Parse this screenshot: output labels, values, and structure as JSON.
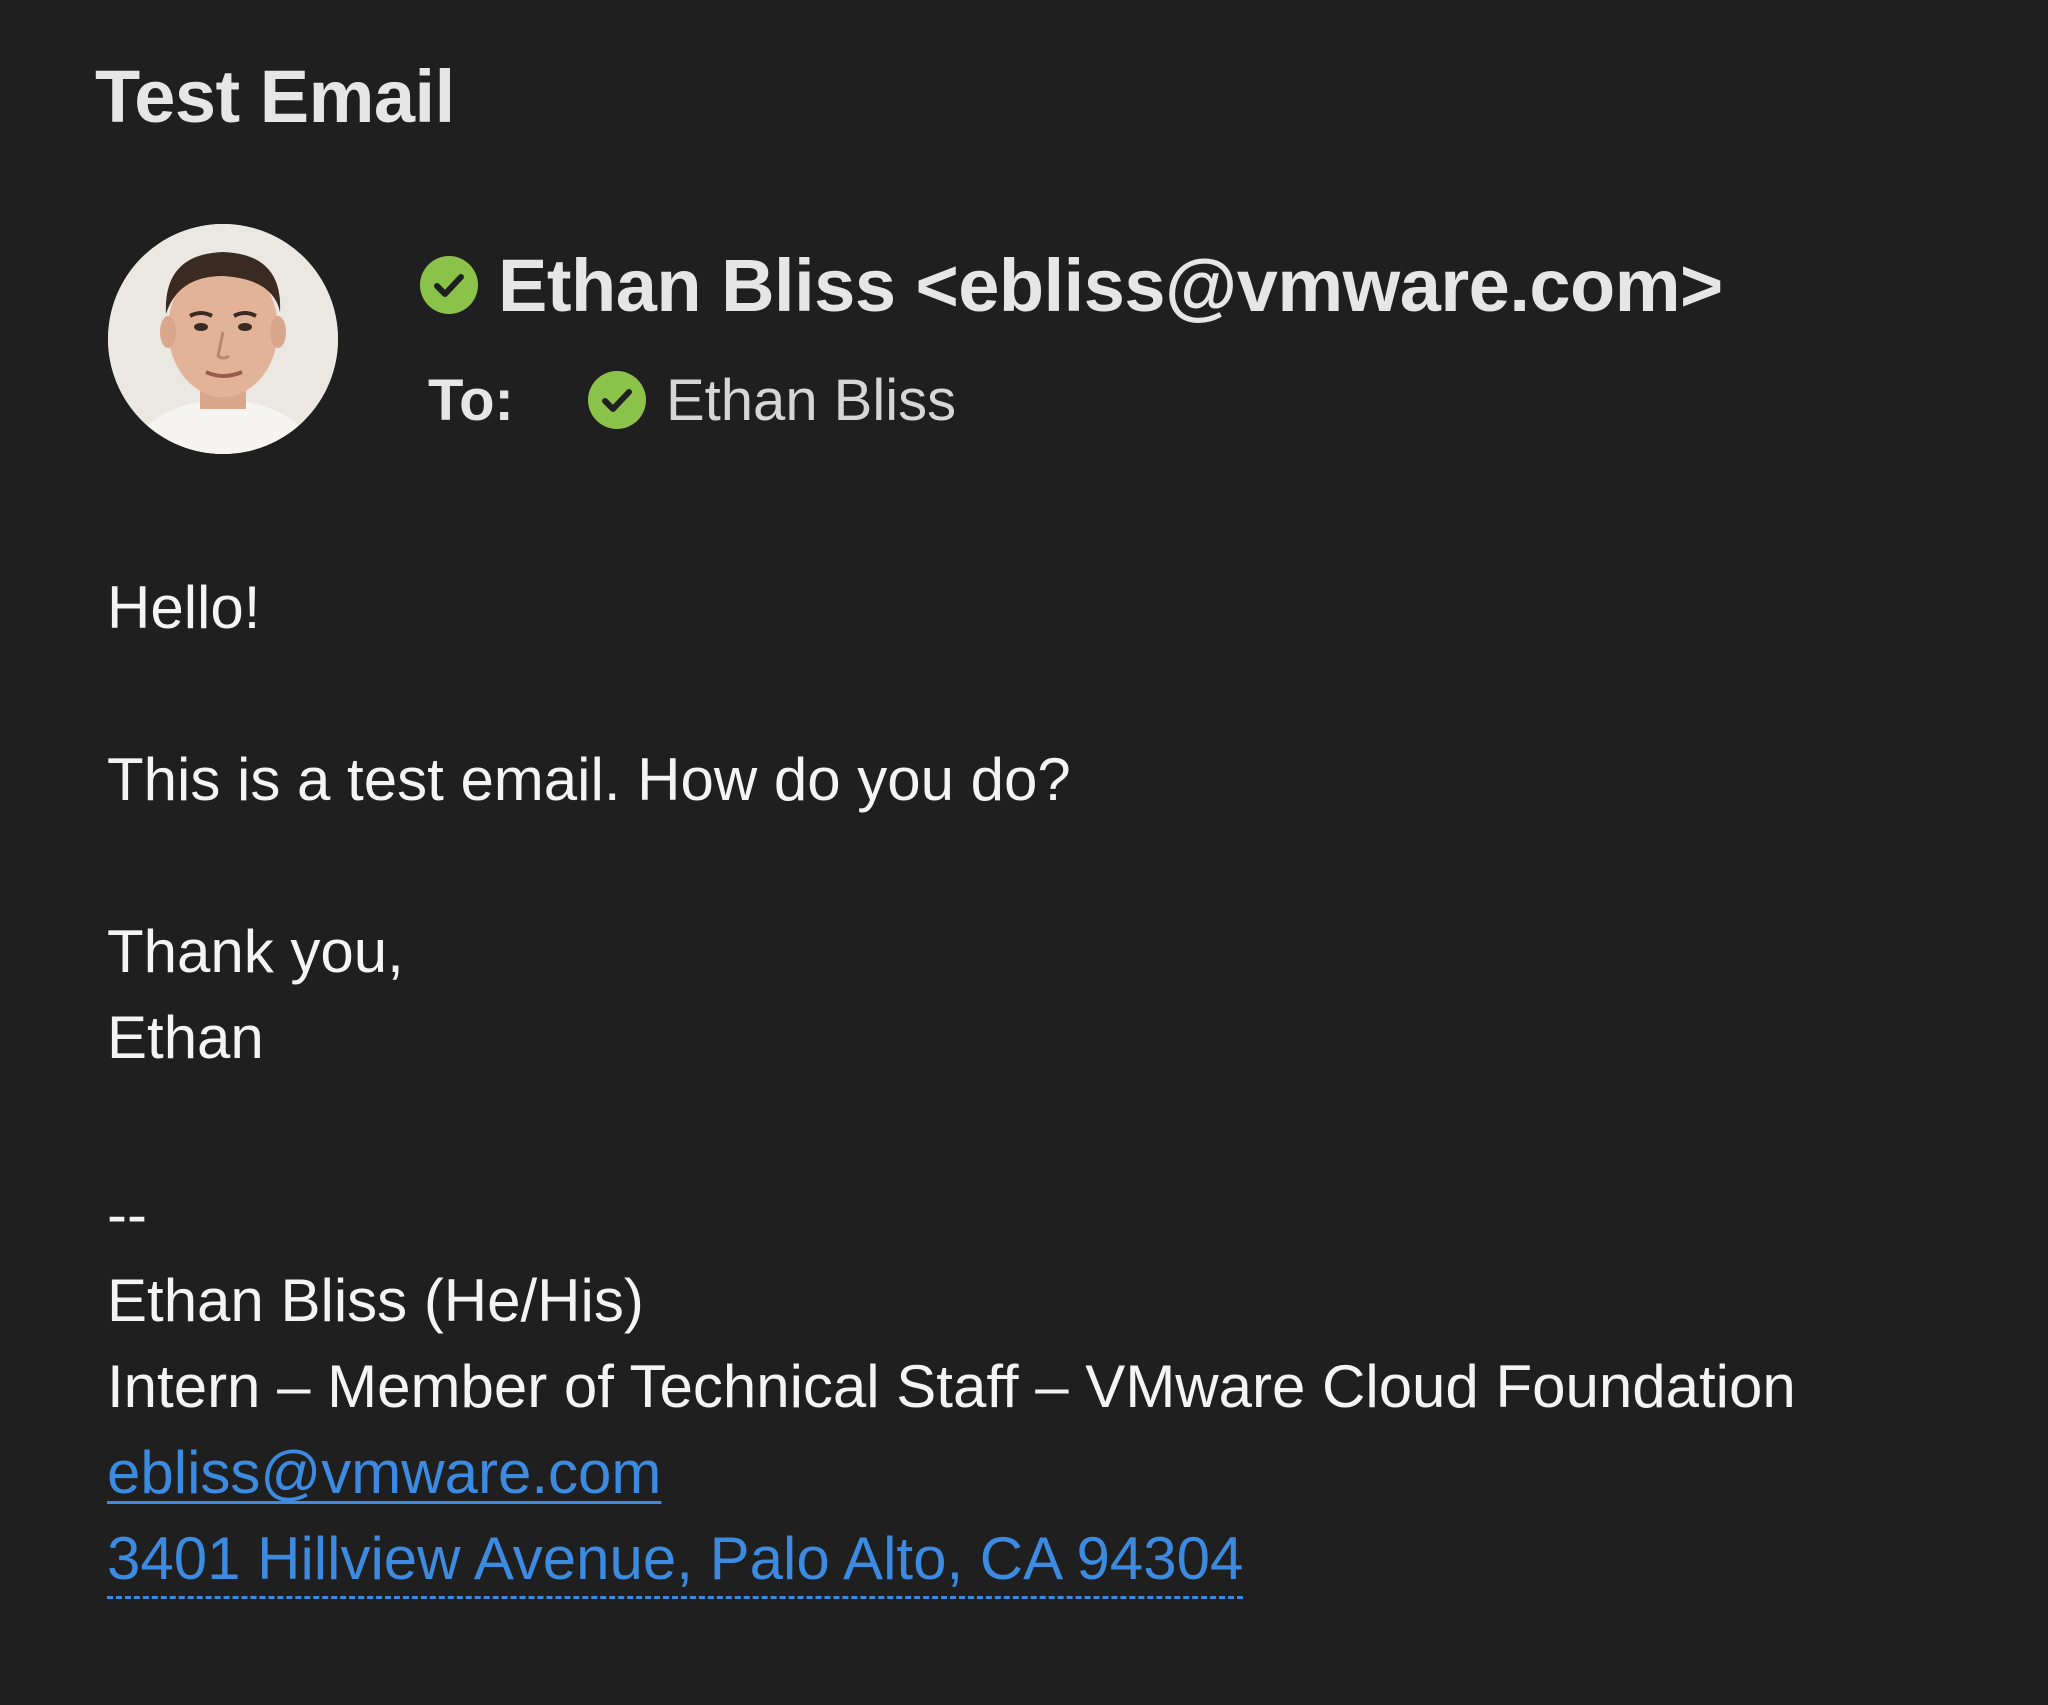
{
  "email": {
    "subject": "Test Email",
    "from": "Ethan Bliss <ebliss@vmware.com>",
    "to_label": "To:",
    "to_name": "Ethan Bliss",
    "verified_color": "#8bc34a",
    "icons": {
      "sender_verified": "check-circle-icon",
      "recipient_verified": "check-circle-icon",
      "avatar": "sender-avatar"
    }
  },
  "body": {
    "greeting": "Hello!",
    "message": "This is a test email. How do you do?",
    "closing": "Thank you,",
    "name": "Ethan"
  },
  "signature": {
    "separator": "--",
    "name": "Ethan Bliss (He/His)",
    "title": "Intern – Member of Technical Staff – VMware Cloud Foundation",
    "email": "ebliss@vmware.com",
    "address": "3401 Hillview Avenue, Palo Alto, CA 94304",
    "link_color": "#3d8be0"
  }
}
